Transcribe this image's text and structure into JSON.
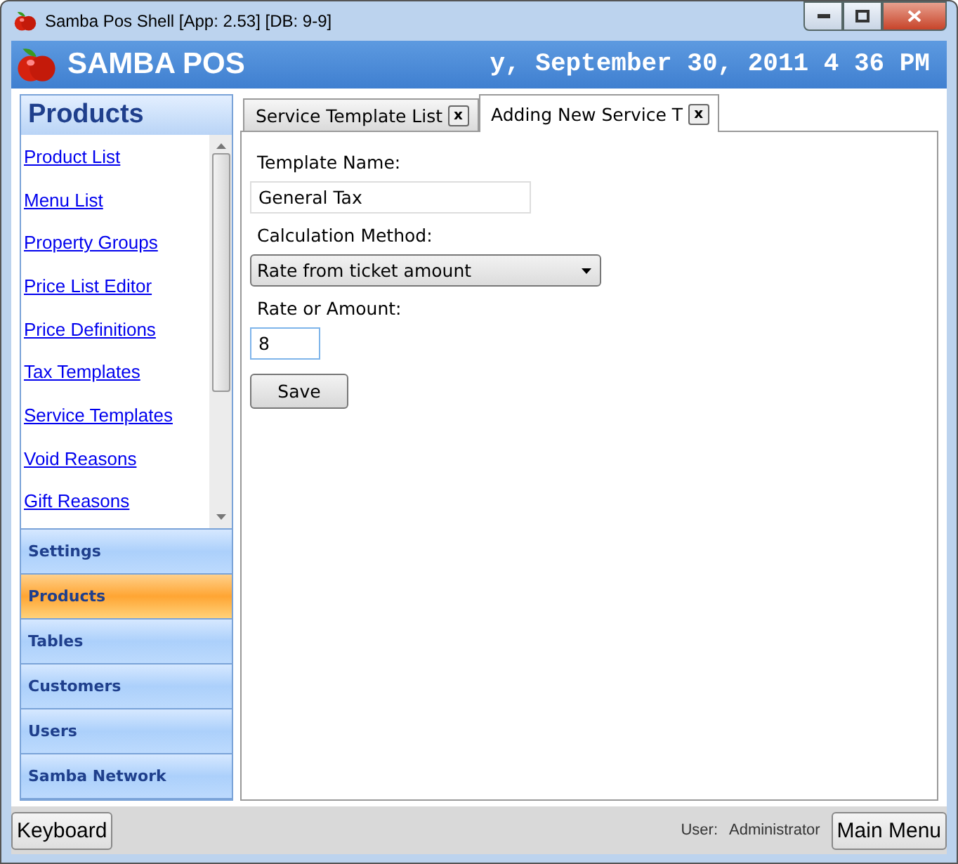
{
  "window": {
    "title": "Samba Pos Shell [App: 2.53] [DB: 9-9]"
  },
  "header": {
    "brand": "SAMBA POS",
    "clock": "y, September 30, 2011 4 36 PM"
  },
  "sidebar": {
    "title": "Products",
    "links": [
      "Product List",
      "Menu List",
      "Property Groups",
      "Price List Editor",
      "Price Definitions",
      "Tax Templates",
      "Service Templates",
      "Void Reasons",
      "Gift Reasons"
    ],
    "sections": [
      {
        "label": "Settings",
        "selected": false
      },
      {
        "label": "Products",
        "selected": true
      },
      {
        "label": "Tables",
        "selected": false
      },
      {
        "label": "Customers",
        "selected": false
      },
      {
        "label": "Users",
        "selected": false
      },
      {
        "label": "Samba Network",
        "selected": false
      }
    ]
  },
  "tabs": [
    {
      "label": "Service Template List",
      "close": "x",
      "selected": false
    },
    {
      "label": "Adding New Service T",
      "close": "x",
      "selected": true
    }
  ],
  "form": {
    "fields": [
      {
        "label": "Template Name:",
        "kind": "text",
        "value": "General Tax"
      },
      {
        "label": "Calculation Method:",
        "kind": "select",
        "value": "Rate from ticket amount"
      },
      {
        "label": "Rate or Amount:",
        "kind": "short",
        "value": "8"
      }
    ],
    "save": "Save"
  },
  "status_bar": {
    "keyboard": "Keyboard",
    "user_label": "User:",
    "user": "Administrator",
    "main_menu": "Main Menu"
  }
}
